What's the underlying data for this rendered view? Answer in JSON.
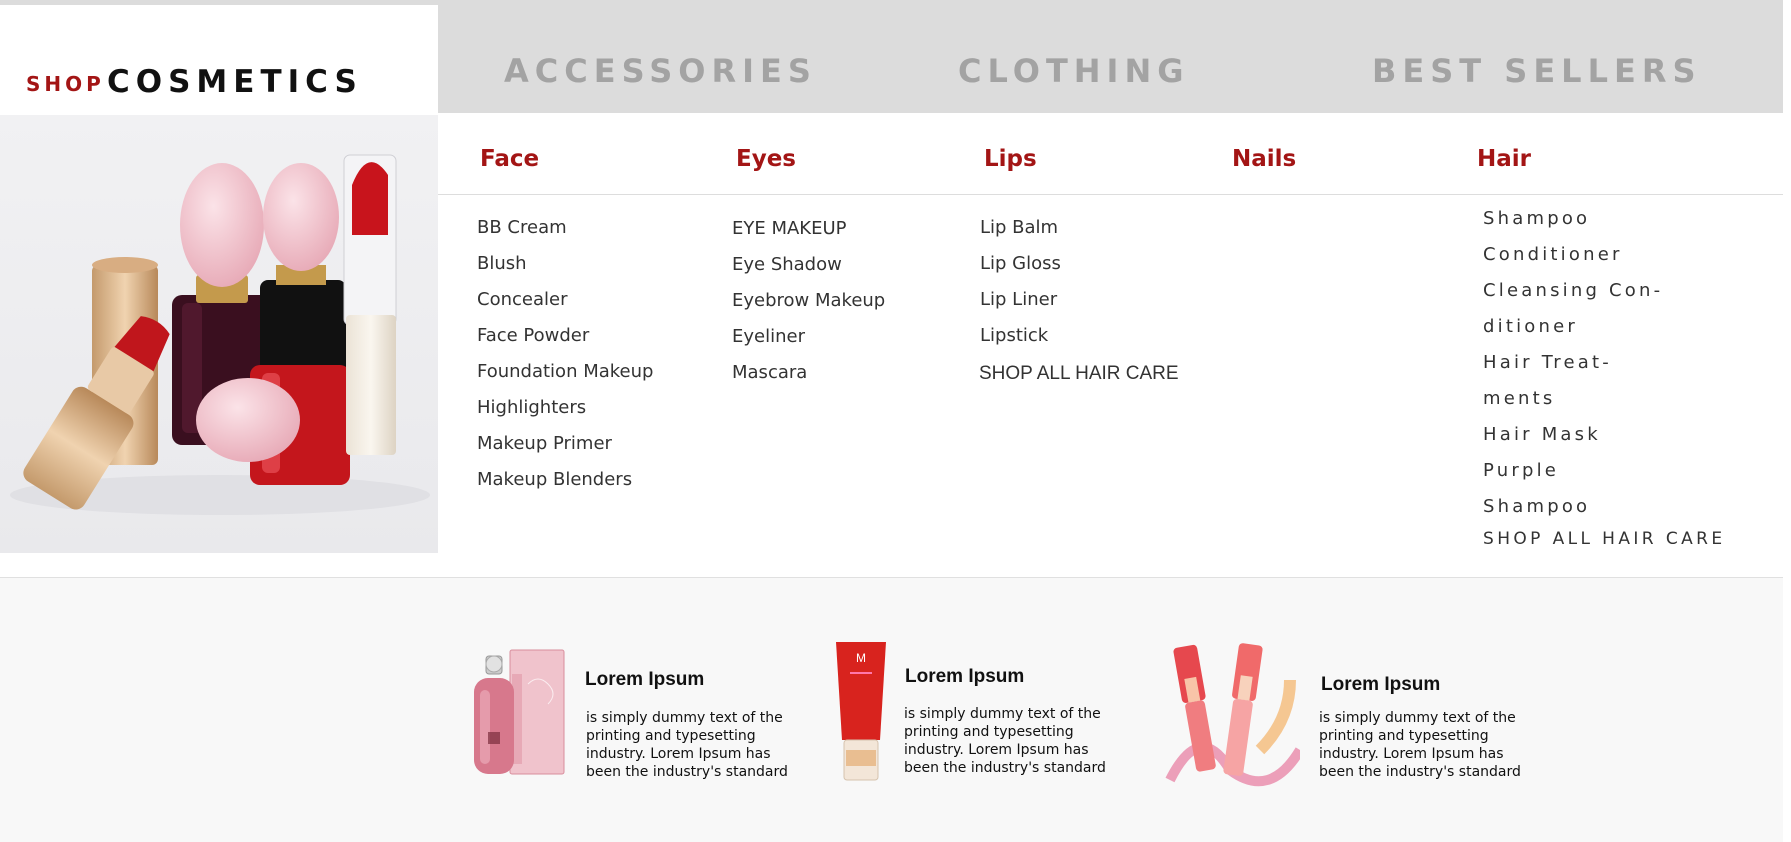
{
  "header": {
    "shop_label": "SHOP",
    "shop_title": "COSMETICS",
    "nav": [
      "ACCESSORIES",
      "CLOTHING",
      "BEST SELLERS"
    ]
  },
  "menu": {
    "face": {
      "heading": "Face",
      "items": [
        "BB Cream",
        "Blush",
        "Concealer",
        "Face Powder",
        "Foundation Makeup",
        "Highlighters",
        "Makeup Primer",
        "Makeup Blenders"
      ]
    },
    "eyes": {
      "heading": "Eyes",
      "items": [
        "EYE MAKEUP",
        "Eye Shadow",
        "Eyebrow Makeup",
        "Eyeliner",
        "Mascara"
      ]
    },
    "lips": {
      "heading": "Lips",
      "items": [
        "Lip Balm",
        "Lip Gloss",
        "Lip Liner",
        "Lipstick"
      ],
      "shop_all": "SHOP ALL HAIR CARE"
    },
    "nails": {
      "heading": "Nails"
    },
    "hair": {
      "heading": "Hair",
      "lines": [
        "Shampoo",
        "Conditioner",
        "Cleansing Con-",
        "ditioner",
        "Hair Treat-",
        "ments",
        "Hair Mask",
        "Purple",
        "Shampoo"
      ],
      "shop_all": "SHOP ALL HAIR CARE"
    }
  },
  "promos": [
    {
      "title": "Lorem Ipsum",
      "text": " is simply dummy text of the printing and typesetting industry. Lorem Ipsum has been the industry's standard"
    },
    {
      "title": "Lorem Ipsum",
      "text": " is simply dummy text of the printing and typesetting industry. Lorem Ipsum has been the industry's standard"
    },
    {
      "title": "Lorem Ipsum",
      "text": " is simply dummy text of the printing and typesetting industry. Lorem Ipsum has been the industry's standard"
    }
  ],
  "colors": {
    "accent": "#a31515",
    "nav_inactive": "#a3a3a3",
    "header_bg": "#dcdcdc",
    "footer_bg": "#f8f8f8"
  }
}
